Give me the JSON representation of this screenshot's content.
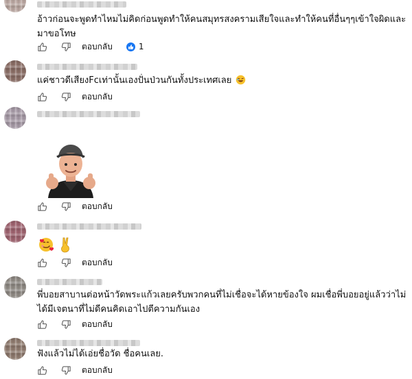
{
  "comments": [
    {
      "avatar_color": "#b9a6a0",
      "text_lines": [
        "อ้าวก่อนจะพูดทำไหมไม่คิดก่อนพูดทำให้คนสมุทรสงครามเสียใจและทำให้คนที่อื่นๆๆเข้าใจผิดและ",
        "มาขอโทษ"
      ],
      "reply_label": "ตอบกลับ",
      "reaction_icon": "thumbs-up-reaction-icon",
      "reaction_count": "1"
    },
    {
      "avatar_color": "#8a6e66",
      "text_lines": [
        "แค่ชาวดีเสียงFcเท่านั้นเองปั่นป่วนกันทั้งประเทศเลย"
      ],
      "trailing_emoji": "rolling-laughing-emoji",
      "reply_label": "ตอบกลับ"
    },
    {
      "avatar_color": "#a69aa6",
      "sticker": "cartoon-man-thumbs-up-sticker",
      "reply_label": "ตอบกลับ"
    },
    {
      "avatar_color": "#9e6470",
      "emojis": [
        "smiling-face-with-hearts-emoji",
        "victory-hand-emoji"
      ],
      "reply_label": "ตอบกลับ"
    },
    {
      "avatar_color": "#8f8a84",
      "text_lines": [
        "พี่บอยสาบานต่อหน้าวัดพระแก้วเลยครับพวกคนที่ไม่เชื่อจะได้หายข้องใจ ผมเชื่อพี่บอยอยู่แล้วว่าไม่",
        "ได้มีเจตนาที่ไม่ดีคนคิดเอาไปตีความกันเอง"
      ],
      "reply_label": "ตอบกลับ"
    },
    {
      "avatar_color": "#8e7a6e",
      "text_lines": [
        "ฟังแล้วไม่ได้เอ่ยชื่อวัด ชื่อคนเลย."
      ],
      "reply_label": "ตอบกลับ"
    }
  ],
  "colors": {
    "icon": "#606060",
    "reaction_blue": "#1877f2"
  }
}
